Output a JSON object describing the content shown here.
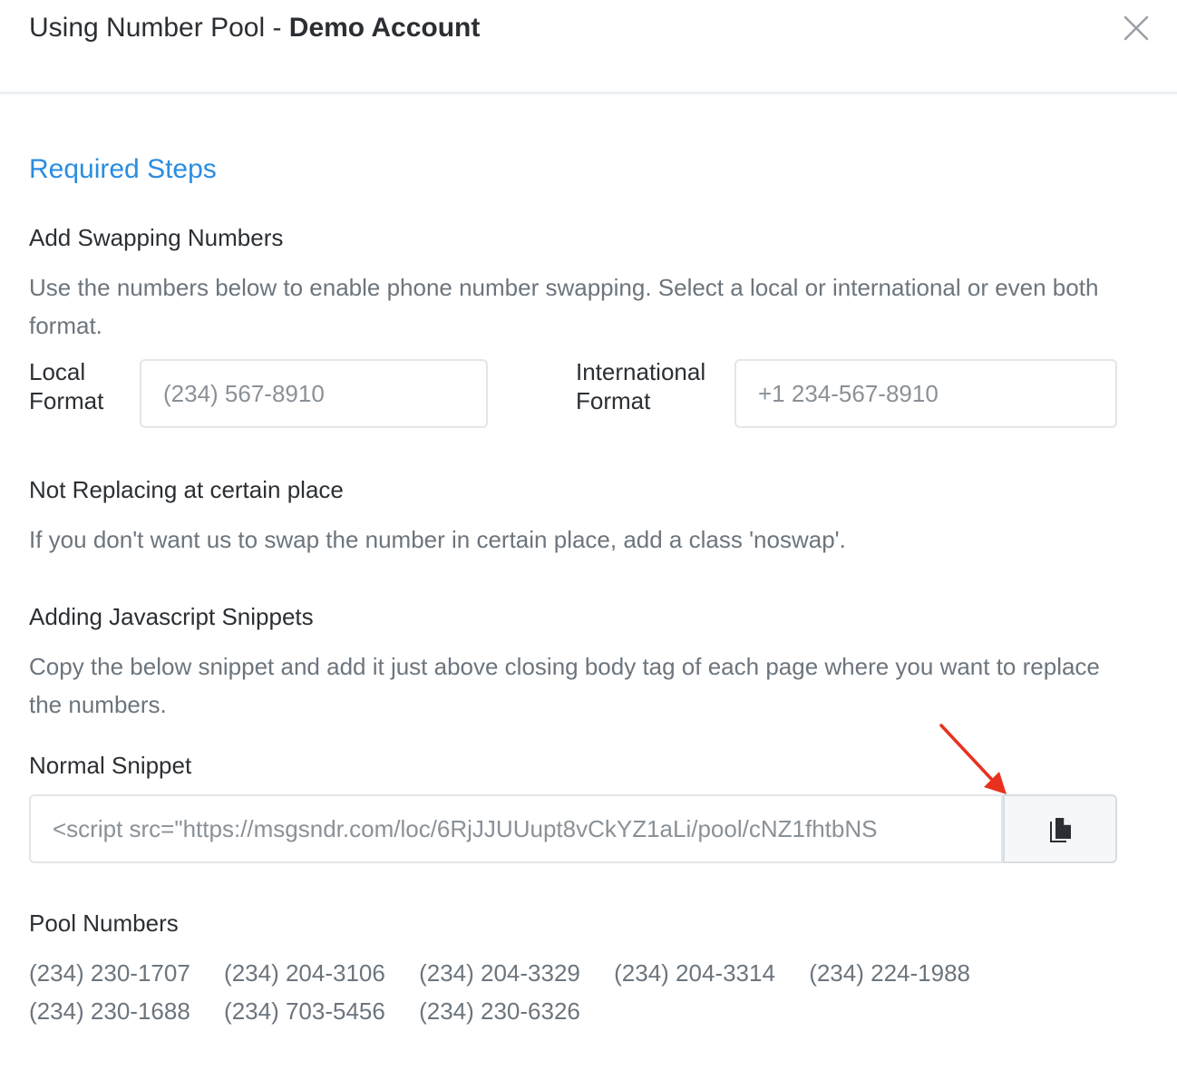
{
  "header": {
    "title_prefix": "Using Number Pool - ",
    "account_name": "Demo Account"
  },
  "section_title": "Required Steps",
  "swap": {
    "heading": "Add Swapping Numbers",
    "description": "Use the numbers below to enable phone number swapping. Select a local or international or even both format.",
    "local_label": "Local Format",
    "local_placeholder": "(234) 567-8910",
    "intl_label": "International Format",
    "intl_placeholder": "+1 234-567-8910"
  },
  "noswap": {
    "heading": "Not Replacing at certain place",
    "description": "If you don't want us to swap the number in certain place, add a class 'noswap'."
  },
  "snippets": {
    "heading": "Adding Javascript Snippets",
    "description": "Copy the below snippet and add it just above closing body tag of each page where you want to replace the numbers.",
    "normal_label": "Normal Snippet",
    "normal_value": "<script src=\"https://msgsndr.com/loc/6RjJJUUupt8vCkYZ1aLi/pool/cNZ1fhtbNS",
    "copy_icon": "copy-icon",
    "annotation_color": "#e8321f"
  },
  "pool": {
    "heading": "Pool Numbers",
    "numbers": [
      "(234) 230-1707",
      "(234) 204-3106",
      "(234) 204-3329",
      "(234) 204-3314",
      "(234) 224-1988",
      "(234) 230-1688",
      "(234) 703-5456",
      "(234) 230-6326"
    ]
  },
  "colors": {
    "accent": "#2a8de0",
    "text": "#2b2f33",
    "muted": "#6c757d"
  }
}
